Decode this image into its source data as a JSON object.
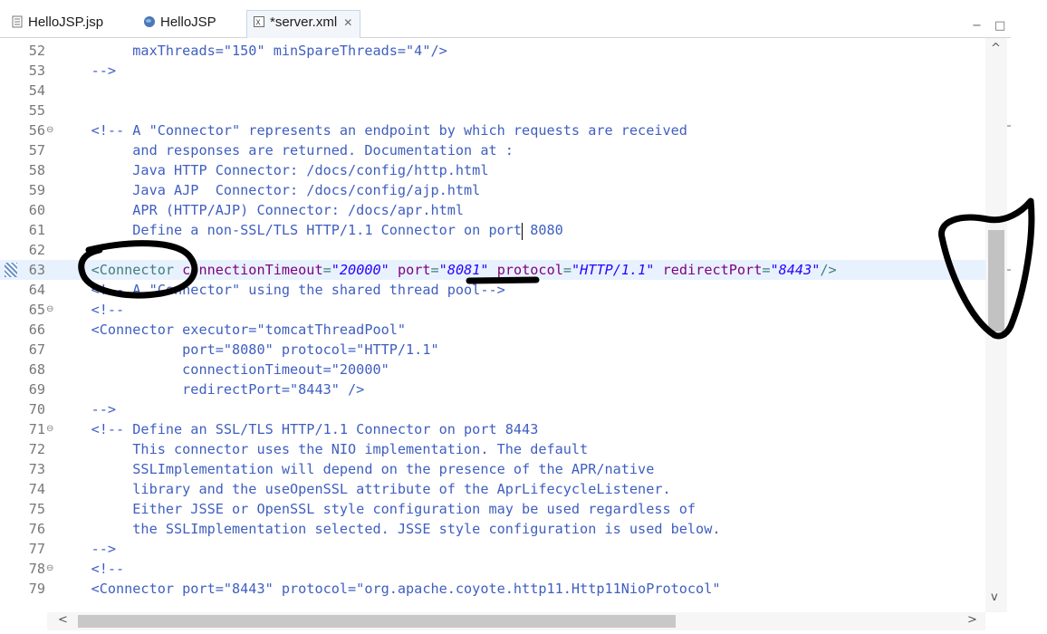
{
  "tabs": [
    {
      "label": "HelloJSP.jsp",
      "icon": "jsp-file-icon",
      "active": false
    },
    {
      "label": "HelloJSP",
      "icon": "globe-icon",
      "active": false
    },
    {
      "label": "*server.xml",
      "icon": "xml-file-icon",
      "active": true
    }
  ],
  "window_controls": {
    "minimize": "−",
    "maximize": "□"
  },
  "editor": {
    "current_line": 63,
    "lines": [
      {
        "num": "52",
        "fold": "",
        "segments": [
          {
            "t": "         maxThreads=\"150\" minSpareThreads=\"4\"/>",
            "c": "cmt"
          }
        ]
      },
      {
        "num": "53",
        "fold": "",
        "segments": [
          {
            "t": "    -->",
            "c": "cmt"
          }
        ]
      },
      {
        "num": "54",
        "fold": "",
        "segments": []
      },
      {
        "num": "55",
        "fold": "",
        "segments": []
      },
      {
        "num": "56",
        "fold": "⊖",
        "segments": [
          {
            "t": "    <!-- A \"Connector\" represents an endpoint by which requests are received",
            "c": "cmt"
          }
        ]
      },
      {
        "num": "57",
        "fold": "",
        "segments": [
          {
            "t": "         and responses are returned. Documentation at :",
            "c": "cmt"
          }
        ]
      },
      {
        "num": "58",
        "fold": "",
        "segments": [
          {
            "t": "         Java HTTP Connector: /docs/config/http.html",
            "c": "cmt"
          }
        ]
      },
      {
        "num": "59",
        "fold": "",
        "segments": [
          {
            "t": "         Java AJP  Connector: /docs/config/ajp.html",
            "c": "cmt"
          }
        ]
      },
      {
        "num": "60",
        "fold": "",
        "segments": [
          {
            "t": "         APR (HTTP/AJP) Connector: /docs/apr.html",
            "c": "cmt"
          }
        ]
      },
      {
        "num": "61",
        "fold": "",
        "segments": [
          {
            "t": "         Define a non-SSL/TLS HTTP/1.1 Connector on port 8080",
            "c": "cmt"
          }
        ]
      },
      {
        "num": "62",
        "fold": "",
        "segments": []
      },
      {
        "num": "63",
        "fold": "",
        "segments": [
          {
            "t": "    <Connector ",
            "c": "tag"
          },
          {
            "t": "connectionTimeout",
            "c": "attr"
          },
          {
            "t": "=",
            "c": "tag"
          },
          {
            "t": "\"20000\"",
            "c": "val"
          },
          {
            "t": " ",
            "c": "tag"
          },
          {
            "t": "port",
            "c": "attr"
          },
          {
            "t": "=",
            "c": "tag"
          },
          {
            "t": "\"8081\"",
            "c": "val"
          },
          {
            "t": " ",
            "c": "tag"
          },
          {
            "t": "protocol",
            "c": "attr"
          },
          {
            "t": "=",
            "c": "tag"
          },
          {
            "t": "\"HTTP/1.1\"",
            "c": "val"
          },
          {
            "t": " ",
            "c": "tag"
          },
          {
            "t": "redirectPort",
            "c": "attr"
          },
          {
            "t": "=",
            "c": "tag"
          },
          {
            "t": "\"8443\"",
            "c": "val"
          },
          {
            "t": "/>",
            "c": "tag"
          }
        ]
      },
      {
        "num": "64",
        "fold": "",
        "segments": [
          {
            "t": "    <!-- A \"Connector\" using the shared thread pool-->",
            "c": "cmt"
          }
        ]
      },
      {
        "num": "65",
        "fold": "⊖",
        "segments": [
          {
            "t": "    <!--",
            "c": "cmt"
          }
        ]
      },
      {
        "num": "66",
        "fold": "",
        "segments": [
          {
            "t": "    <Connector executor=\"tomcatThreadPool\"",
            "c": "cmt"
          }
        ]
      },
      {
        "num": "67",
        "fold": "",
        "segments": [
          {
            "t": "               port=\"8080\" protocol=\"HTTP/1.1\"",
            "c": "cmt"
          }
        ]
      },
      {
        "num": "68",
        "fold": "",
        "segments": [
          {
            "t": "               connectionTimeout=\"20000\"",
            "c": "cmt"
          }
        ]
      },
      {
        "num": "69",
        "fold": "",
        "segments": [
          {
            "t": "               redirectPort=\"8443\" />",
            "c": "cmt"
          }
        ]
      },
      {
        "num": "70",
        "fold": "",
        "segments": [
          {
            "t": "    -->",
            "c": "cmt"
          }
        ]
      },
      {
        "num": "71",
        "fold": "⊖",
        "segments": [
          {
            "t": "    <!-- Define an SSL/TLS HTTP/1.1 Connector on port 8443",
            "c": "cmt"
          }
        ]
      },
      {
        "num": "72",
        "fold": "",
        "segments": [
          {
            "t": "         This connector uses the NIO implementation. The default",
            "c": "cmt"
          }
        ]
      },
      {
        "num": "73",
        "fold": "",
        "segments": [
          {
            "t": "         SSLImplementation will depend on the presence of the APR/native",
            "c": "cmt"
          }
        ]
      },
      {
        "num": "74",
        "fold": "",
        "segments": [
          {
            "t": "         library and the useOpenSSL attribute of the AprLifecycleListener.",
            "c": "cmt"
          }
        ]
      },
      {
        "num": "75",
        "fold": "",
        "segments": [
          {
            "t": "         Either JSSE or OpenSSL style configuration may be used regardless of",
            "c": "cmt"
          }
        ]
      },
      {
        "num": "76",
        "fold": "",
        "segments": [
          {
            "t": "         the SSLImplementation selected. JSSE style configuration is used below.",
            "c": "cmt"
          }
        ]
      },
      {
        "num": "77",
        "fold": "",
        "segments": [
          {
            "t": "    -->",
            "c": "cmt"
          }
        ]
      },
      {
        "num": "78",
        "fold": "⊖",
        "segments": [
          {
            "t": "    <!--",
            "c": "cmt"
          }
        ]
      },
      {
        "num": "79",
        "fold": "",
        "segments": [
          {
            "t": "    <Connector port=\"8443\" protocol=\"org.apache.coyote.http11.Http11NioProtocol\"",
            "c": "cmt"
          }
        ]
      }
    ]
  },
  "scrollbars": {
    "up": "^",
    "down": "v",
    "left": "<",
    "right": ">"
  },
  "colors": {
    "comment": "#3f5fbf",
    "tag": "#3f7f7f",
    "attribute": "#7f007f",
    "value": "#2a00ff",
    "current_line": "#e8f2fe",
    "annotation_ink": "#000000"
  }
}
